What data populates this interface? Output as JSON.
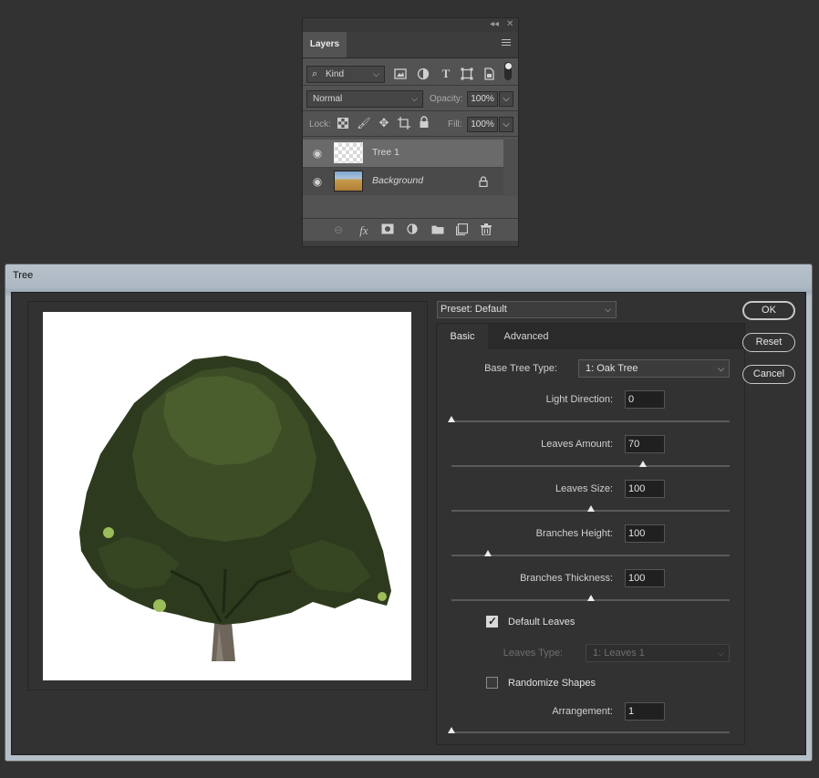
{
  "layers_panel": {
    "tab_label": "Layers",
    "filter_kind": "Kind",
    "blend_mode": "Normal",
    "opacity_label": "Opacity:",
    "opacity_value": "100%",
    "lock_label": "Lock:",
    "fill_label": "Fill:",
    "fill_value": "100%",
    "layers": [
      {
        "name": "Tree 1",
        "selected": true
      },
      {
        "name": "Background",
        "locked": true
      }
    ]
  },
  "dialog": {
    "title": "Tree",
    "preset": "Preset: Default",
    "tabs": [
      "Basic",
      "Advanced"
    ],
    "base_tree_type_label": "Base Tree Type:",
    "base_tree_type_value": "1: Oak Tree",
    "light_direction_label": "Light Direction:",
    "light_direction_value": "0",
    "light_direction_fraction": 0.0,
    "leaves_amount_label": "Leaves Amount:",
    "leaves_amount_value": "70",
    "leaves_amount_fraction": 0.69,
    "leaves_size_label": "Leaves Size:",
    "leaves_size_value": "100",
    "leaves_size_fraction": 0.5,
    "branches_height_label": "Branches Height:",
    "branches_height_value": "100",
    "branches_height_fraction": 0.13,
    "branches_thickness_label": "Branches Thickness:",
    "branches_thickness_value": "100",
    "branches_thickness_fraction": 0.5,
    "default_leaves_label": "Default Leaves",
    "default_leaves_checked": true,
    "leaves_type_label": "Leaves Type:",
    "leaves_type_value": "1: Leaves 1",
    "randomize_shapes_label": "Randomize Shapes",
    "randomize_shapes_checked": false,
    "arrangement_label": "Arrangement:",
    "arrangement_value": "1",
    "arrangement_fraction": 0.0,
    "buttons": {
      "ok": "OK",
      "reset": "Reset",
      "cancel": "Cancel"
    }
  }
}
